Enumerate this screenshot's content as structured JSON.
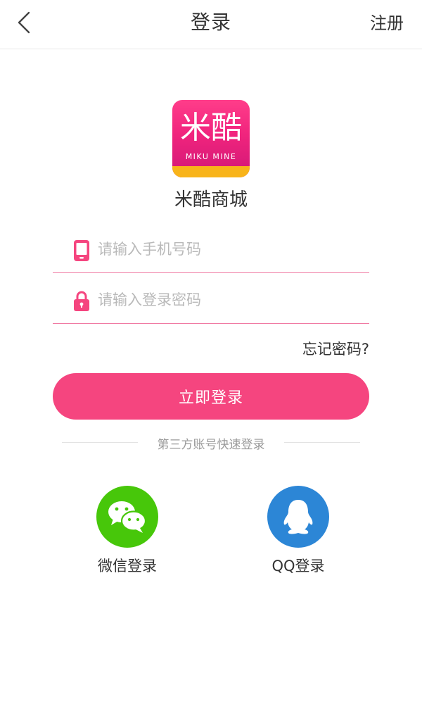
{
  "header": {
    "title": "登录",
    "register_label": "注册",
    "back_icon": "chevron-left-icon"
  },
  "logo": {
    "text_cn": "米酷",
    "text_en": "MIKU MINE"
  },
  "app_name": "米酷商城",
  "form": {
    "phone": {
      "placeholder": "请输入手机号码",
      "value": "",
      "icon": "phone-icon"
    },
    "password": {
      "placeholder": "请输入登录密码",
      "value": "",
      "icon": "lock-icon"
    },
    "forgot_label": "忘记密码?",
    "submit_label": "立即登录"
  },
  "third_party": {
    "divider_text": "第三方账号快速登录",
    "wechat_label": "微信登录",
    "qq_label": "QQ登录"
  },
  "colors": {
    "accent": "#f5457f",
    "field_underline": "#f07aa3",
    "wechat": "#47c70a",
    "qq": "#2c86d6"
  }
}
